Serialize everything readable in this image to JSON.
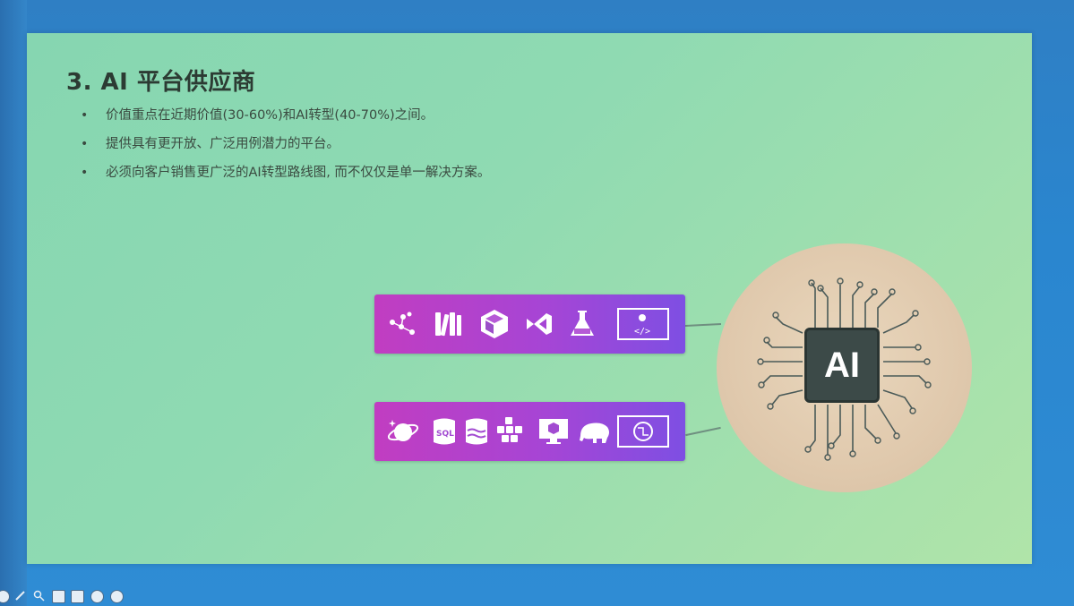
{
  "slide": {
    "title": "3. AI 平台供应商",
    "bullet_marker": "•",
    "bullets": [
      "价值重点在近期价值(30-60%)和AI转型(40-70%)之间。",
      "提供具有更开放、广泛用例潜力的平台。",
      "必须向客户销售更广泛的AI转型路线图, 而不仅仅是单一解决方案。"
    ]
  },
  "diagram": {
    "top_bar_icons": [
      "network-graph-icon",
      "library-books-icon",
      "cube-icon",
      "visual-studio-icon",
      "flask-icon",
      "code-settings-icon"
    ],
    "bottom_bar_icons": [
      "planet-sparkle-icon",
      "sql-database-icon",
      "data-lake-icon",
      "cluster-nodes-icon",
      "monitor-cube-icon",
      "hadoop-elephant-icon",
      "circuit-chip-icon"
    ],
    "chip_label": "AI",
    "colors": {
      "bar_start": "#c13dc1",
      "bar_end": "#7e4fe3",
      "chip_bg": "#3c4a48",
      "circle_bg": "#e0c9ad",
      "slide_bg": "#8fdab2"
    }
  },
  "toolbar": {
    "icons": [
      "prev-icon",
      "pen-icon",
      "zoom-icon",
      "grid-icon",
      "camera-icon",
      "more-icon",
      "next-icon"
    ]
  }
}
